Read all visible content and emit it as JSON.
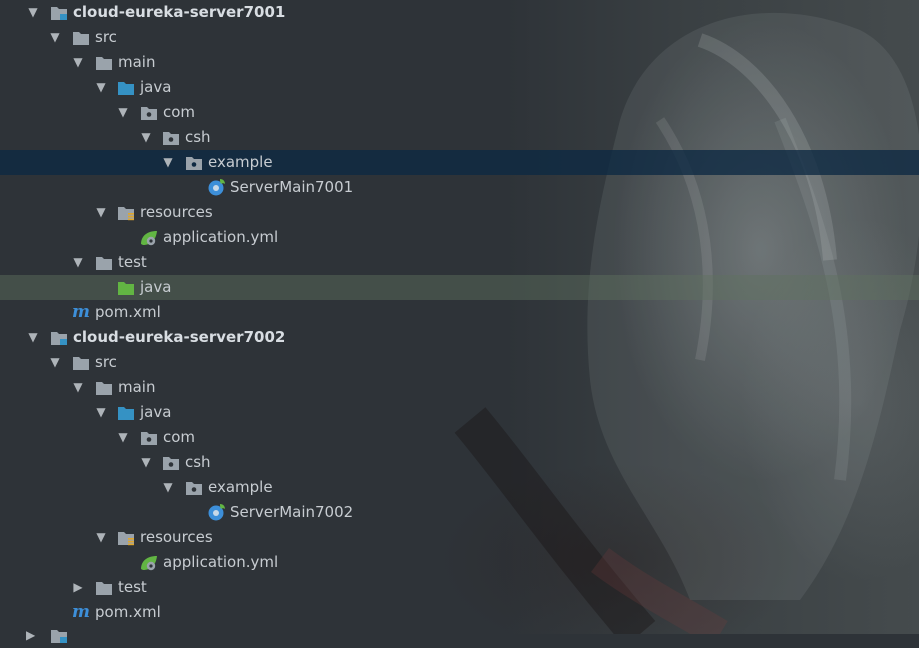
{
  "modules": [
    {
      "name": "cloud-eureka-server7001",
      "src": "src",
      "main": "main",
      "java": "java",
      "com": "com",
      "csh": "csh",
      "example": "example",
      "class_file": "ServerMain7001",
      "resources": "resources",
      "config": "application.yml",
      "test": "test",
      "test_java": "java",
      "pom": "pom.xml"
    },
    {
      "name": "cloud-eureka-server7002",
      "src": "src",
      "main": "main",
      "java": "java",
      "com": "com",
      "csh": "csh",
      "example": "example",
      "class_file": "ServerMain7002",
      "resources": "resources",
      "config": "application.yml",
      "test": "test",
      "pom": "pom.xml"
    }
  ],
  "colors": {
    "selection": "#0d2942",
    "hover_row": "#607060",
    "folder_grey": "#9aa3ab",
    "folder_source": "#3592c4",
    "folder_test": "#62b543",
    "package": "#9aa3ab",
    "resources_marker": "#e0a72c",
    "maven": "#3d8fd9"
  },
  "icons": {
    "module": "module-folder-icon",
    "folder": "folder-icon",
    "source_root": "source-root-icon",
    "package": "package-icon",
    "resources": "resources-folder-icon",
    "spring_boot_class": "spring-boot-class-icon",
    "spring_config": "spring-config-icon",
    "test_root": "test-root-icon",
    "maven": "maven-icon",
    "expanded": "chevron-down-icon",
    "collapsed": "chevron-right-icon"
  }
}
